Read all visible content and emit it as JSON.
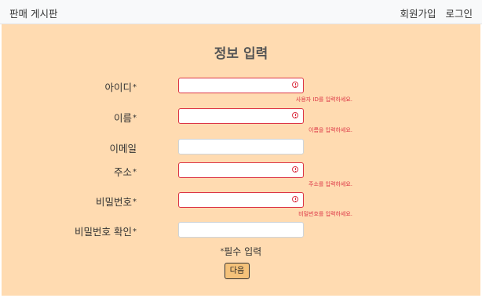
{
  "navbar": {
    "brand": "판매 게시판",
    "links": [
      "회원가입",
      "로그인"
    ]
  },
  "form": {
    "title": "정보 입력",
    "star": "*",
    "fields": [
      {
        "label": "아이디",
        "required": true,
        "value": "",
        "error": "사용자 ID를 입력하세요."
      },
      {
        "label": "이름",
        "required": true,
        "value": "",
        "error": "이름을 입력하세요."
      },
      {
        "label": "이메일",
        "required": false,
        "value": "",
        "error": ""
      },
      {
        "label": "주소",
        "required": true,
        "value": "",
        "error": "주소를 입력하세요."
      },
      {
        "label": "비밀번호",
        "required": true,
        "value": "",
        "error": "비밀번호를 입력하세요."
      },
      {
        "label": "비밀번호 확인",
        "required": true,
        "value": "",
        "error": ""
      }
    ],
    "required_note": "필수 입력",
    "next_button": "다음"
  },
  "colors": {
    "background": "#ffdbb1",
    "error": "#dc3545",
    "button": "#f5c27a"
  }
}
